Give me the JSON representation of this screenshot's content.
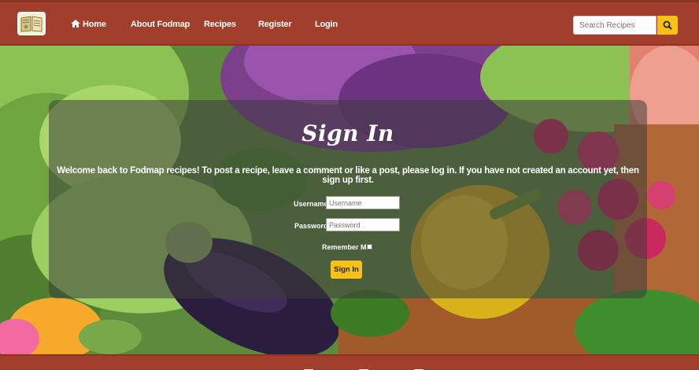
{
  "nav": {
    "logo": "book-logo-icon",
    "home": "Home",
    "about": "About Fodmap",
    "recipes": "Recipes",
    "register": "Register",
    "login": "Login"
  },
  "search": {
    "placeholder": "Search Recipes",
    "icon": "search-icon"
  },
  "signin": {
    "title": "Sign In",
    "intro": "Welcome back to Fodmap recipes! To post a recipe, leave a comment or like a post, please log in. If you have not created an account yet, then sign up first.",
    "username_label": "Username:",
    "username_placeholder": "Username",
    "password_label": "Password:",
    "password_placeholder": "Password",
    "remember_label": "Remember Me:",
    "remember_checked": false,
    "button": "Sign In"
  },
  "colors": {
    "brand": "#a23f2c",
    "accent": "#f7c115"
  }
}
